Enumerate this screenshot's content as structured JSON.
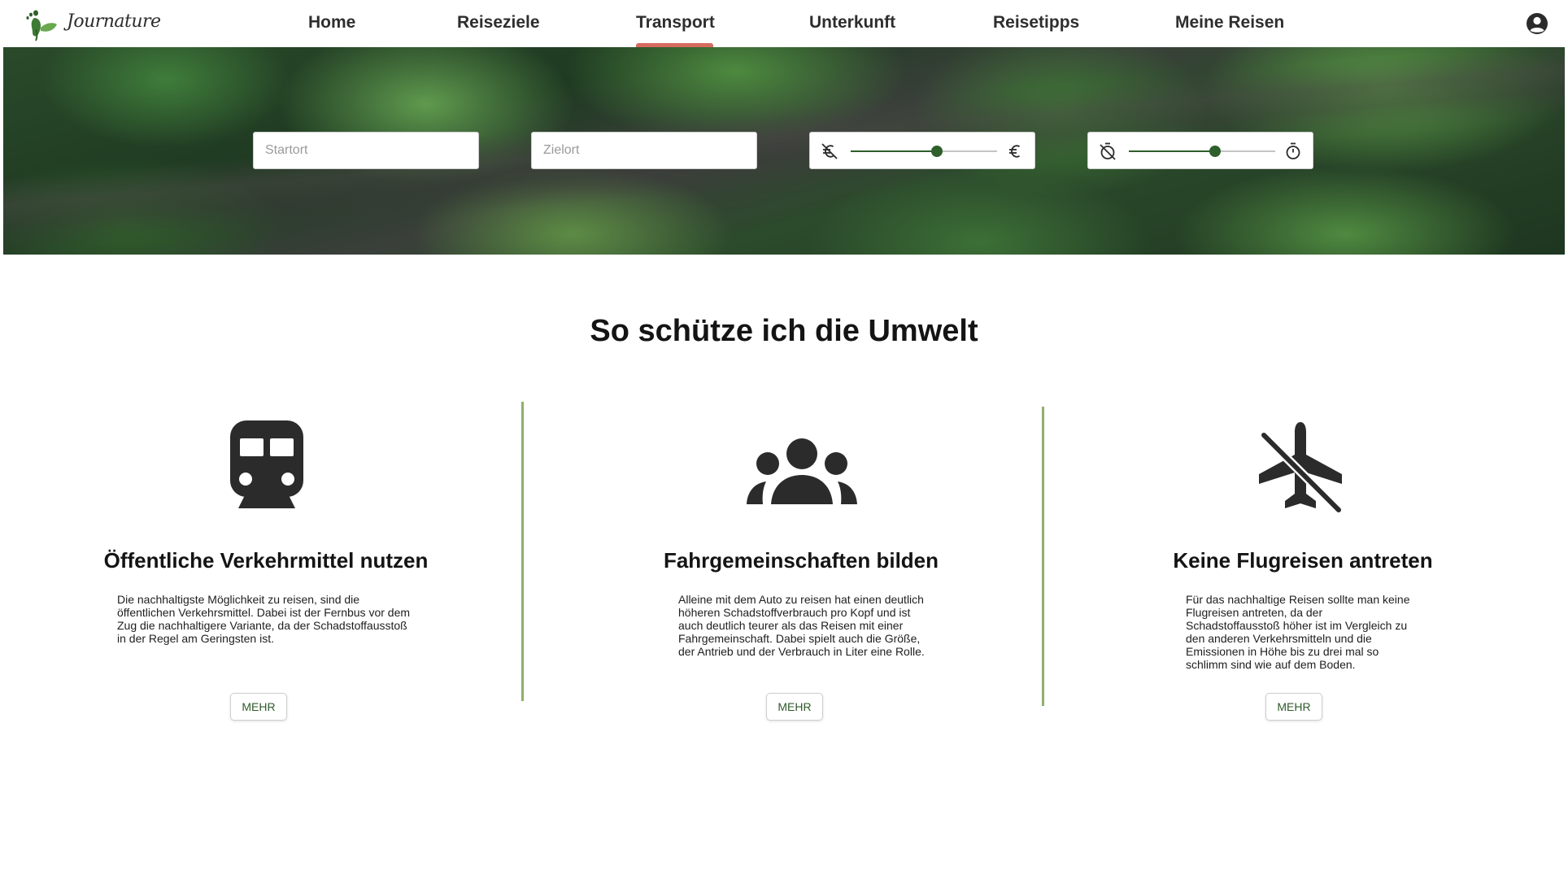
{
  "brand": {
    "name": "Journature"
  },
  "nav": {
    "items": [
      {
        "label": "Home"
      },
      {
        "label": "Reiseziele"
      },
      {
        "label": "Transport",
        "active": true
      },
      {
        "label": "Unterkunft"
      },
      {
        "label": "Reisetipps"
      },
      {
        "label": "Meine Reisen"
      }
    ]
  },
  "search": {
    "start_placeholder": "Startort",
    "start_value": "",
    "destination_placeholder": "Zielort",
    "destination_value": "",
    "cost_slider": {
      "min_icon": "no-money-icon",
      "max_icon": "euro-icon",
      "level": 0.59
    },
    "time_slider": {
      "min_icon": "timer-off-icon",
      "max_icon": "timer-icon",
      "level": 0.59
    }
  },
  "section": {
    "title": "So schütze ich die Umwelt"
  },
  "cards": [
    {
      "icon": "train-icon",
      "title": "Öffentliche Verkehrmittel nutzen",
      "lines": [
        "Die nachhaltigste Möglichkeit zu reisen, sind die",
        "öffentlichen Verkehrsmittel. Dabei ist der Fernbus vor dem",
        "Zug die nachhaltigere Variante, da der Schadstoffausstoß",
        "in der Regel am Geringsten ist."
      ],
      "button": "MEHR"
    },
    {
      "icon": "group-icon",
      "title": "Fahrgemeinschaften bilden",
      "lines": [
        "Alleine mit dem Auto zu reisen hat einen deutlich",
        "höheren Schadstoffverbrauch pro Kopf und ist",
        "auch deutlich teurer als das Reisen mit einer",
        "Fahrgemeinschaft. Dabei spielt auch die Größe,",
        "der Antrieb und der Verbrauch in Liter eine Rolle."
      ],
      "button": "MEHR"
    },
    {
      "icon": "airplane-off-icon",
      "title": "Keine Flugreisen antreten",
      "lines": [
        "Für das nachhaltige Reisen sollte man keine",
        "Flugreisen antreten, da der",
        "Schadstoffausstoß höher ist im Vergleich zu",
        "den anderen Verkehrsmitteln und die",
        "Emissionen in Höhe bis zu drei mal so",
        "schlimm sind wie auf dem Boden."
      ],
      "button": "MEHR"
    }
  ],
  "colors": {
    "accent_green": "#2f5f2a",
    "divider_green": "#8fb06b",
    "active_underline": "#d66b5f",
    "icon_dark": "#2b2b2b"
  }
}
